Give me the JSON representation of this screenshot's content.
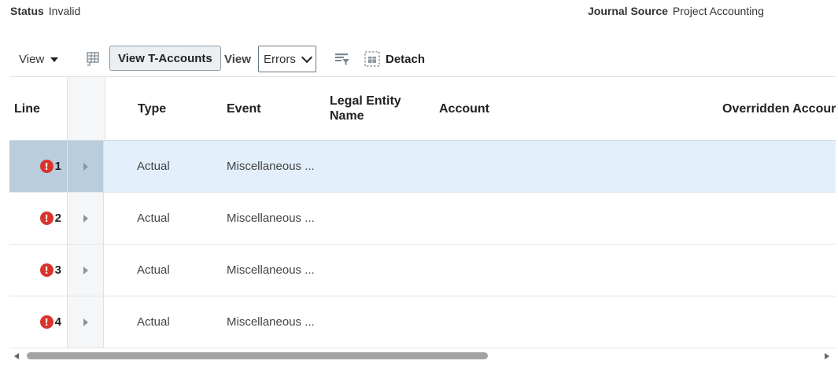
{
  "status": {
    "label": "Status",
    "value": "Invalid"
  },
  "journal_source": {
    "label": "Journal Source",
    "value": "Project Accounting"
  },
  "toolbar": {
    "view_menu_label": "View",
    "view_taccounts_label": "View T-Accounts",
    "view_label": "View",
    "view_select_value": "Errors",
    "detach_label": "Detach"
  },
  "table": {
    "columns": {
      "line": "Line",
      "type": "Type",
      "event": "Event",
      "legal_entity_line1": "Legal Entity",
      "legal_entity_line2": "Name",
      "account": "Account",
      "overridden_account": "Overridden Accour"
    },
    "rows": [
      {
        "line": "1",
        "type": "Actual",
        "event": "Miscellaneous ..."
      },
      {
        "line": "2",
        "type": "Actual",
        "event": "Miscellaneous ..."
      },
      {
        "line": "3",
        "type": "Actual",
        "event": "Miscellaneous ..."
      },
      {
        "line": "4",
        "type": "Actual",
        "event": "Miscellaneous ..."
      }
    ],
    "error_glyph": "!"
  },
  "colors": {
    "error": "#d9342b",
    "selected_row": "#e2effb",
    "selected_line_cell": "#b9cddd"
  },
  "icons": [
    "freeze-columns-icon",
    "filter-icon",
    "detach-icon",
    "error-icon",
    "expand-row-icon"
  ]
}
